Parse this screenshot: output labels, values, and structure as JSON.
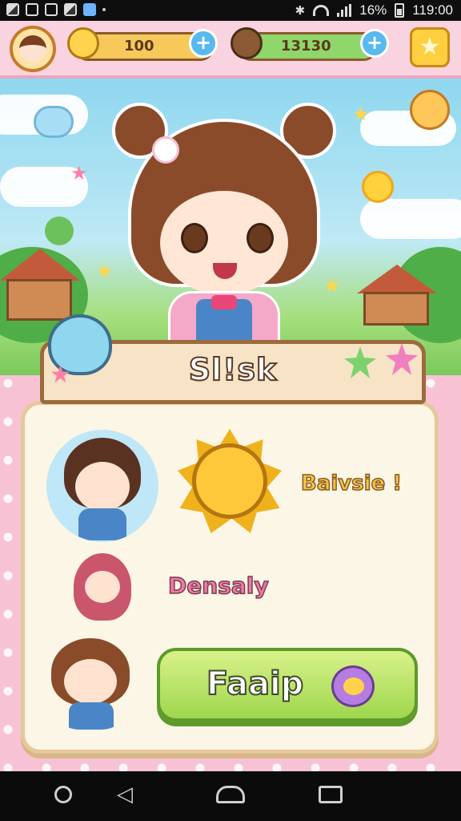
{
  "status_bar": {
    "time": "119:00",
    "battery_text": "16%"
  },
  "hud": {
    "coins": "100",
    "gems": "13130",
    "avatar_icon": "player-avatar-icon",
    "star_icon": "star-icon"
  },
  "panel": {
    "title": "Sl!sk",
    "reward_label": "Baivsie !",
    "character_label": "Densaly",
    "play_button_label": "Faaip"
  },
  "colors": {
    "accent_green": "#9fd64d",
    "accent_pink": "#f07aa6",
    "accent_yellow": "#f6c24a",
    "panel_bg": "#fbf6e6"
  },
  "nav": {
    "back_icon": "back-icon",
    "home_icon": "home-icon",
    "recent_icon": "recent-apps-icon",
    "circle_icon": "assistant-circle-icon"
  }
}
